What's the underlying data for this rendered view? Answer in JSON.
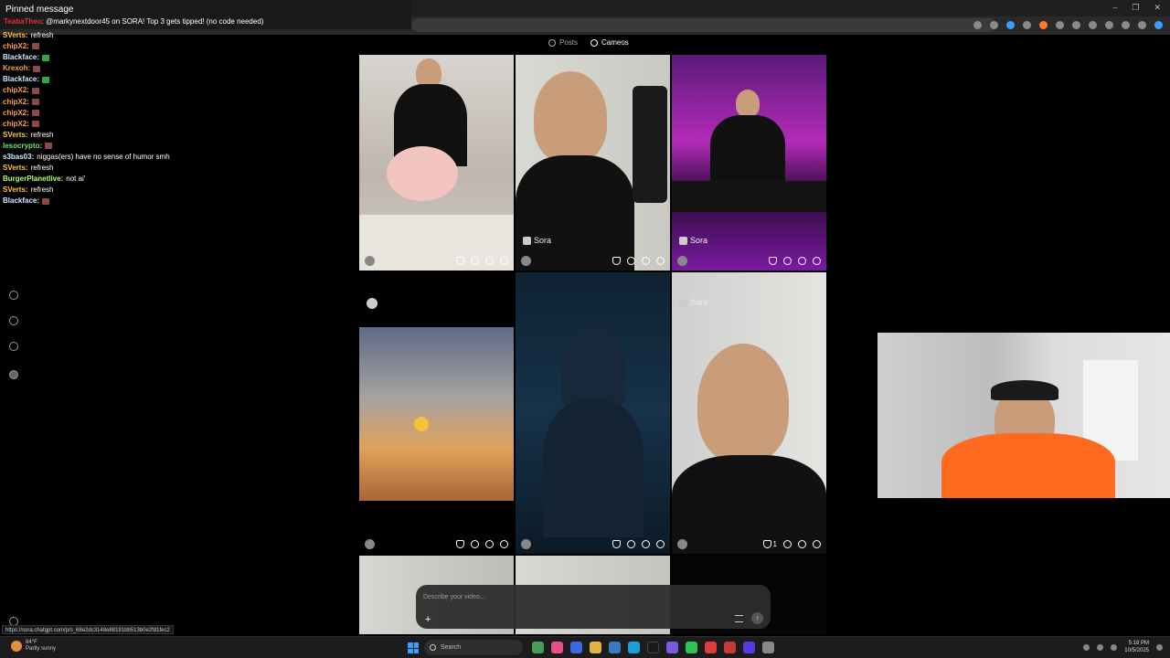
{
  "pinned": {
    "title": "Pinned message",
    "author": "TeabaTheo",
    "text": ": @markynextdoor45 on SORA! Top 3 gets tipped! (no code needed)"
  },
  "chat": [
    {
      "user": "SVerts:",
      "color": "#ffc83d",
      "text": "refresh",
      "emote": ""
    },
    {
      "user": "chipX2:",
      "color": "#ff9f40",
      "text": "",
      "emote": "red"
    },
    {
      "user": "Blackface:",
      "color": "#cfe9ff",
      "text": "",
      "emote": "green"
    },
    {
      "user": "Krexoh:",
      "color": "#ff9f40",
      "text": "",
      "emote": "red"
    },
    {
      "user": "Blackface:",
      "color": "#cfe9ff",
      "text": "",
      "emote": "green"
    },
    {
      "user": "chipX2:",
      "color": "#ff9f40",
      "text": "",
      "emote": "red"
    },
    {
      "user": "chipX2:",
      "color": "#ff9f40",
      "text": "",
      "emote": "red"
    },
    {
      "user": "chipX2:",
      "color": "#ff9f40",
      "text": "",
      "emote": "red"
    },
    {
      "user": "chipX2:",
      "color": "#ff9f40",
      "text": "",
      "emote": "red"
    },
    {
      "user": "SVerts:",
      "color": "#ffc83d",
      "text": "refresh",
      "emote": ""
    },
    {
      "user": "lesocrypto:",
      "color": "#6fe36f",
      "text": "",
      "emote": "red"
    },
    {
      "user": "s3bas03:",
      "color": "#cfe9ff",
      "text": "niggas(ers) have no sense of humor smh",
      "emote": ""
    },
    {
      "user": "SVerts:",
      "color": "#ffc83d",
      "text": "refresh",
      "emote": ""
    },
    {
      "user": "BurgerPlanetlive:",
      "color": "#b5ff6a",
      "text": "not ai'",
      "emote": ""
    },
    {
      "user": "SVerts:",
      "color": "#ffc83d",
      "text": "refresh",
      "emote": ""
    },
    {
      "user": "Blackface:",
      "color": "#cfe9ff",
      "text": "",
      "emote": "red"
    }
  ],
  "feed": {
    "tabs": [
      {
        "label": "Posts",
        "icon": "play-circle-icon",
        "active": false
      },
      {
        "label": "Cameos",
        "icon": "cameo-icon",
        "active": true
      }
    ],
    "sora_label": "Sora",
    "like_count": "1"
  },
  "prompt": {
    "placeholder": "Describe your video...",
    "plus": "+",
    "send": "↑"
  },
  "status_url": "https://sora.chatgpt.com/p/s_68e2dc3148e88191bb513b0e2fd1fec2",
  "taskbar": {
    "temp": "84°F",
    "weather": "Partly sunny",
    "search": "Search",
    "time": "5:18 PM",
    "date": "10/5/2025"
  },
  "window": {
    "minimize": "–",
    "restore": "❐",
    "close": "✕"
  },
  "colors": {
    "accent": "#3aa0ff",
    "pinned_author": "#dd3333"
  }
}
